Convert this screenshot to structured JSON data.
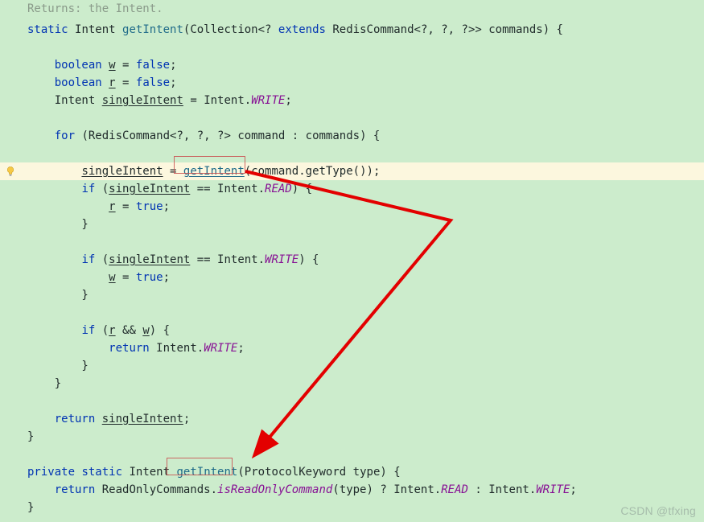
{
  "hints": {
    "returns": "Returns: the Intent."
  },
  "watermark": "CSDN @tfxing",
  "tokens": {
    "kw_static": "static",
    "kw_private": "private",
    "kw_boolean": "boolean",
    "kw_for": "for",
    "kw_if": "if",
    "kw_return": "return",
    "kw_extends": "extends",
    "kw_false": "false",
    "kw_true": "true",
    "sym_eq": " = ",
    "sym_semicolon": ";",
    "type_Intent": "Intent",
    "type_Collection": "Collection",
    "type_RedisCommand": "RedisCommand",
    "type_ProtocolKeyword": "ProtocolKeyword",
    "id_getIntent": "getIntent",
    "id_commands": "commands",
    "id_command": "command",
    "id_w": "w",
    "id_r": "r",
    "id_singleIntent": "singleIntent",
    "id_getType": "getType",
    "id_type": "type",
    "id_ReadOnlyCommands": "ReadOnlyCommands",
    "id_isReadOnlyCommand": "isReadOnlyCommand",
    "fi_WRITE": "WRITE",
    "fi_READ": "READ"
  }
}
